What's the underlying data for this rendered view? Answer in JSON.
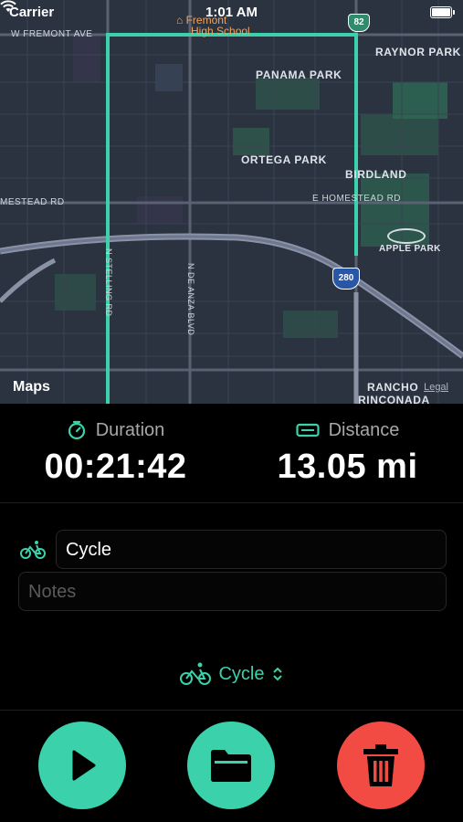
{
  "status_bar": {
    "carrier": "Carrier",
    "time": "1:01 AM"
  },
  "map": {
    "labels": {
      "w_fremont_ave": "W FREMONT AVE",
      "fremont_high_line1": "Fremont",
      "fremont_high_line2": "High School",
      "raynor_park": "RAYNOR PARK",
      "panama_park": "PANAMA PARK",
      "ortega_park": "ORTEGA PARK",
      "birdland": "BIRDLAND",
      "homestead_rd_w": "MESTEAD RD",
      "homestead_rd_e": "E HOMESTEAD RD",
      "apple_park": "APPLE PARK",
      "stelling_rd": "N STELLING RD",
      "de_anza_blvd": "N DE ANZA BLVD",
      "rancho_line1": "RANCHO",
      "rancho_line2": "RINCONADA",
      "hwy_82": "82",
      "hwy_280": "280",
      "maps_logo": "Maps",
      "legal": "Legal"
    },
    "route_color": "#3bd1aa"
  },
  "stats": {
    "duration_label": "Duration",
    "duration_value": "00:21:42",
    "distance_label": "Distance",
    "distance_value": "13.05 mi"
  },
  "form": {
    "name_value": "Cycle",
    "notes_placeholder": "Notes"
  },
  "activity_picker": {
    "label": "Cycle"
  },
  "buttons": {
    "play_icon": "play-icon",
    "folder_icon": "folder-icon",
    "trash_icon": "trash-icon"
  },
  "colors": {
    "accent": "#3bd1aa",
    "danger": "#f14b43",
    "background": "#000000"
  }
}
